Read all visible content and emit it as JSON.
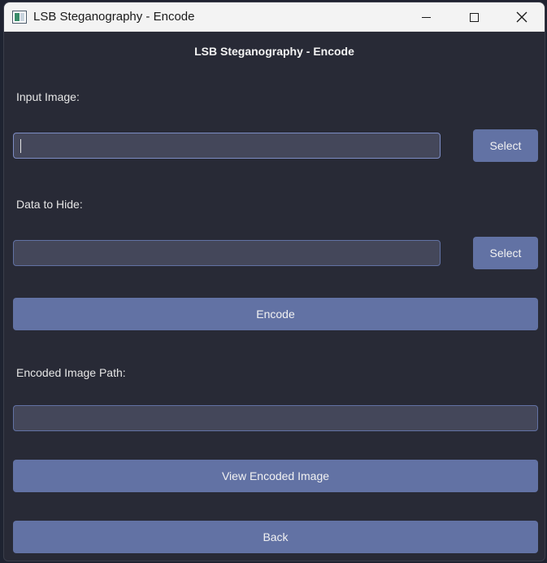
{
  "window": {
    "title": "LSB Steganography - Encode"
  },
  "main": {
    "heading": "LSB Steganography - Encode",
    "input_image": {
      "label": "Input Image:",
      "value": "",
      "select_label": "Select"
    },
    "data_to_hide": {
      "label": "Data to Hide:",
      "value": "",
      "select_label": "Select"
    },
    "encode_label": "Encode",
    "encoded_path": {
      "label": "Encoded Image Path:",
      "value": ""
    },
    "view_label": "View Encoded Image",
    "back_label": "Back"
  },
  "colors": {
    "background": "#282a36",
    "field": "#44475a",
    "accent": "#6272a4",
    "text": "#f2f2f2"
  },
  "icons": {
    "app": "app-window-icon",
    "minimize": "minimize-icon",
    "maximize": "maximize-icon",
    "close": "close-icon"
  }
}
